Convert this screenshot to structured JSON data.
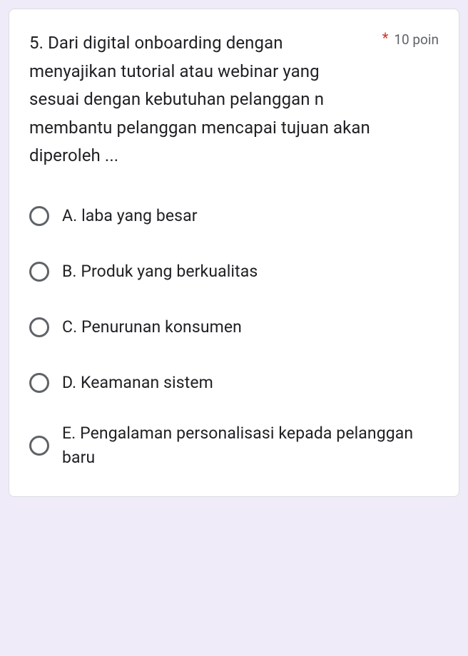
{
  "question": {
    "text": "5. Dari digital onboarding dengan menyajikan tutorial atau webinar yang sesuai dengan kebutuhan pelanggan n membantu pelanggan mencapai tujuan akan diperoleh ...",
    "points": "10 poin",
    "required_marker": "*"
  },
  "options": [
    {
      "label": "A. laba yang besar"
    },
    {
      "label": "B. Produk yang berkualitas"
    },
    {
      "label": "C. Penurunan konsumen"
    },
    {
      "label": "D. Keamanan sistem"
    },
    {
      "label": "E. Pengalaman personalisasi kepada pelanggan baru"
    }
  ]
}
